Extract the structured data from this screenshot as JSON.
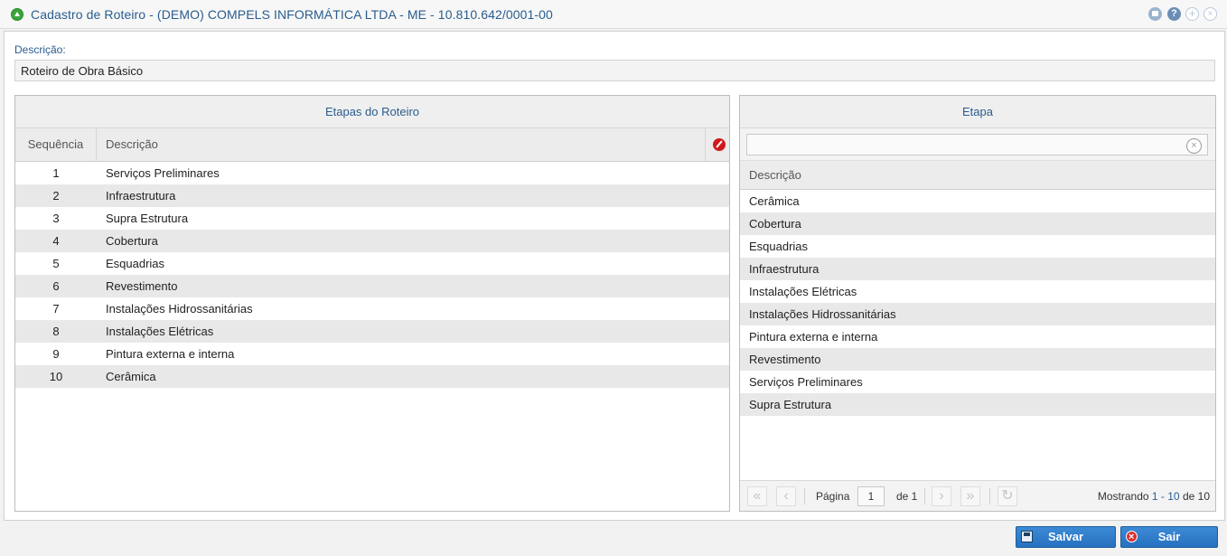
{
  "window": {
    "title": "Cadastro de Roteiro - (DEMO) COMPELS INFORMÁTICA LTDA - ME - 10.810.642/0001-00",
    "help_glyph": "?",
    "max_glyph": "+",
    "close_glyph": "×"
  },
  "form": {
    "descricao_label": "Descrição:",
    "descricao_value": "Roteiro de Obra Básico"
  },
  "left_panel": {
    "title": "Etapas do Roteiro",
    "columns": {
      "seq": "Sequência",
      "desc": "Descrição"
    },
    "rows": [
      {
        "seq": "1",
        "desc": "Serviços Preliminares"
      },
      {
        "seq": "2",
        "desc": "Infraestrutura"
      },
      {
        "seq": "3",
        "desc": "Supra Estrutura"
      },
      {
        "seq": "4",
        "desc": "Cobertura"
      },
      {
        "seq": "5",
        "desc": "Esquadrias"
      },
      {
        "seq": "6",
        "desc": "Revestimento"
      },
      {
        "seq": "7",
        "desc": "Instalações Hidrossanitárias"
      },
      {
        "seq": "8",
        "desc": "Instalações Elétricas"
      },
      {
        "seq": "9",
        "desc": "Pintura externa e interna"
      },
      {
        "seq": "10",
        "desc": "Cerâmica"
      }
    ]
  },
  "right_panel": {
    "title": "Etapa",
    "search_value": "",
    "clear_glyph": "×",
    "column": "Descrição",
    "rows": [
      "Cerâmica",
      "Cobertura",
      "Esquadrias",
      "Infraestrutura",
      "Instalações Elétricas",
      "Instalações Hidrossanitárias",
      "Pintura externa e interna",
      "Revestimento",
      "Serviços Preliminares",
      "Supra Estrutura"
    ],
    "pager": {
      "first_glyph": "«",
      "prev_glyph": "‹",
      "next_glyph": "›",
      "last_glyph": "»",
      "refresh_glyph": "↻",
      "page_label": "Página",
      "page_value": "1",
      "of_label": "de 1",
      "info_prefix": "Mostrando",
      "info_range": "1 - 10",
      "info_de": "de",
      "info_total": "10"
    }
  },
  "buttons": {
    "save": "Salvar",
    "exit": "Sair"
  }
}
